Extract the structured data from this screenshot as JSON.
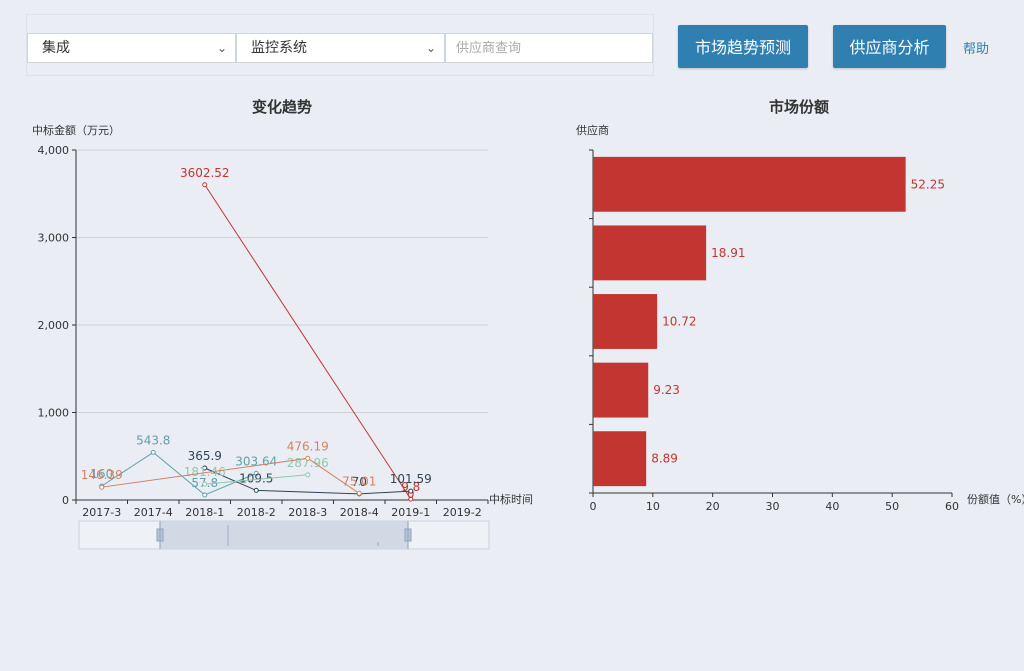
{
  "toolbar": {
    "select1": "集成",
    "select2": "监控系统",
    "search_placeholder": "供应商查询",
    "btn_trend": "市场趋势预测",
    "btn_supplier": "供应商分析",
    "help": "帮助"
  },
  "colors": {
    "series": [
      "#c23531",
      "#61a0a8",
      "#2f4554",
      "#91c7ae",
      "#d48265"
    ],
    "bar": "#c23531",
    "button": "#2f7fb0"
  },
  "chart_data": [
    {
      "type": "line",
      "title": "变化趋势",
      "ylabel": "中标金额（万元）",
      "xlabel": "中标时间",
      "categories": [
        "2017-3",
        "2017-4",
        "2018-1",
        "2018-2",
        "2018-3",
        "2018-4",
        "2019-1",
        "2019-2"
      ],
      "ylim": [
        0,
        4000
      ],
      "yticks": [
        "0",
        "1,000",
        "2,000",
        "3,000",
        "4,000"
      ],
      "grid": true,
      "series": [
        {
          "color": "#c23531",
          "points": [
            [
              2,
              3602.52
            ],
            [
              6,
              9.8
            ]
          ],
          "labels": [
            "3602.52",
            "9.8"
          ],
          "last_label": "0",
          "last_value": 0
        },
        {
          "color": "#61a0a8",
          "points": [
            [
              0,
              160
            ],
            [
              1,
              543.8
            ],
            [
              2,
              57.8
            ],
            [
              3,
              303.64
            ]
          ],
          "labels": [
            "160",
            "543.8",
            "57.8",
            "303.64"
          ]
        },
        {
          "color": "#2f4554",
          "points": [
            [
              2,
              365.9
            ],
            [
              3,
              109.5
            ],
            [
              5,
              70
            ],
            [
              6,
              101.59
            ]
          ],
          "labels": [
            "365.9",
            "109.5",
            "70",
            "101.59"
          ]
        },
        {
          "color": "#91c7ae",
          "points": [
            [
              2,
              181.46
            ],
            [
              4,
              287.96
            ]
          ],
          "labels": [
            "181.46",
            "287.96"
          ]
        },
        {
          "color": "#d48265",
          "points": [
            [
              0,
              146.39
            ],
            [
              4,
              476.19
            ],
            [
              5,
              75.01
            ]
          ],
          "labels": [
            "146.39",
            "476.19",
            "75.01"
          ]
        }
      ]
    },
    {
      "type": "bar",
      "orientation": "horizontal",
      "title": "市场份额",
      "ylabel": "供应商",
      "xlabel": "份额值（%）",
      "values": [
        52.25,
        18.91,
        10.72,
        9.23,
        8.89
      ],
      "value_labels": [
        "52.25",
        "18.91",
        "10.72",
        "9.23",
        "8.89"
      ],
      "xlim": [
        0,
        60
      ],
      "xticks": [
        "0",
        "10",
        "20",
        "30",
        "40",
        "50",
        "60"
      ],
      "color": "#c23531"
    }
  ]
}
